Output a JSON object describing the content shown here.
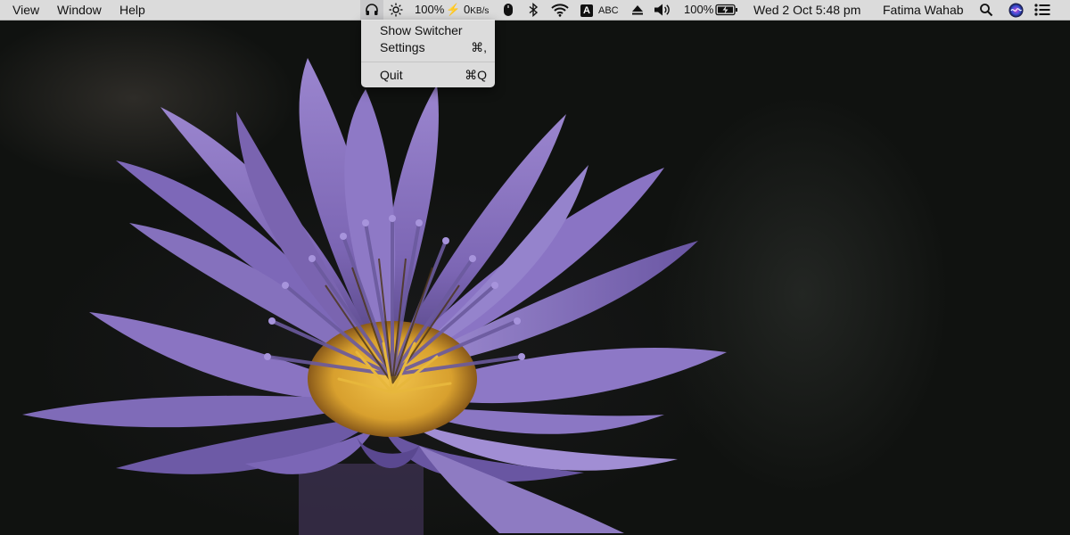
{
  "menubar": {
    "left_menus": [
      "View",
      "Window",
      "Help"
    ],
    "status": {
      "headphones_icon": "headphones-icon",
      "brightness_icon": "sun-icon",
      "brightness_percent": "100%",
      "network_speed": "0",
      "network_unit": "KB/s",
      "input_source_letter": "A",
      "input_source_name": "ABC",
      "battery_percent": "100%",
      "datetime": "Wed 2 Oct  5:48 pm",
      "user_name": "Fatima Wahab"
    }
  },
  "dropdown": {
    "items": [
      {
        "label": "Show Switcher",
        "shortcut": ""
      },
      {
        "label": "Settings",
        "shortcut": "⌘,"
      },
      {
        "label": "Quit",
        "shortcut": "⌘Q"
      }
    ]
  },
  "colors": {
    "menubar_bg": "#e4e4e4",
    "petal": "#8a73c0",
    "flower_center": "#e2b23a",
    "background": "#101210"
  }
}
